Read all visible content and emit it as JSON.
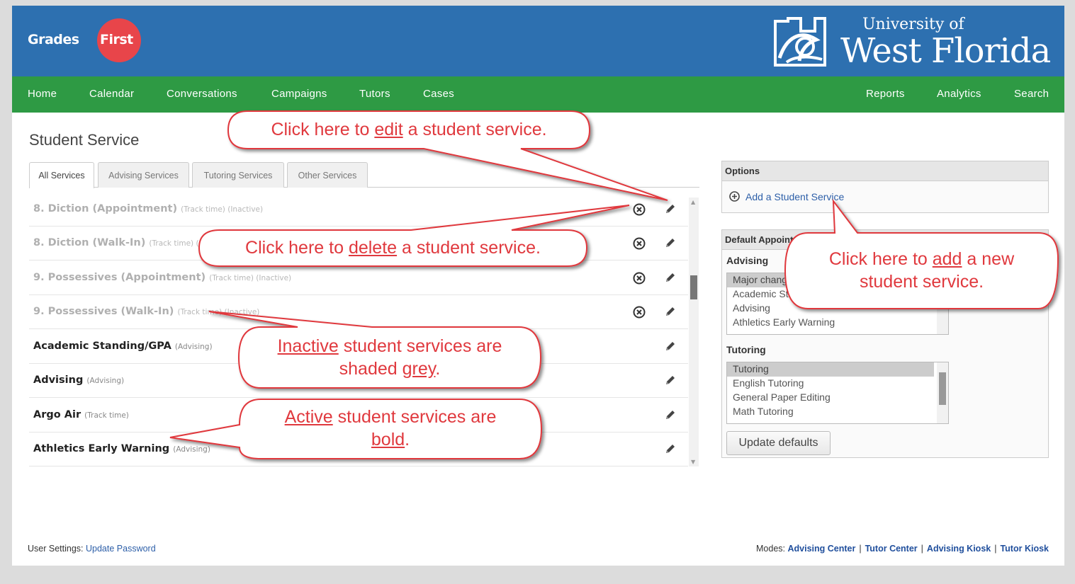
{
  "brand": {
    "gf_part1": "Grades",
    "gf_part2": "First",
    "uni_line1": "University of",
    "uni_line2": "West Florida"
  },
  "nav": {
    "left": [
      "Home",
      "Calendar",
      "Conversations",
      "Campaigns",
      "Tutors",
      "Cases"
    ],
    "right": [
      "Reports",
      "Analytics",
      "Search"
    ]
  },
  "page": {
    "title": "Student Service"
  },
  "tabs": [
    "All Services",
    "Advising Services",
    "Tutoring Services",
    "Other Services"
  ],
  "services": [
    {
      "name": "8. Diction (Appointment)",
      "meta": "(Track time) (Inactive)",
      "status": "inactive"
    },
    {
      "name": "8. Diction (Walk-In)",
      "meta": "(Track time) (Inactive)",
      "status": "inactive"
    },
    {
      "name": "9. Possessives (Appointment)",
      "meta": "(Track time) (Inactive)",
      "status": "inactive"
    },
    {
      "name": "9. Possessives (Walk-In)",
      "meta": "(Track time) (Inactive)",
      "status": "inactive"
    },
    {
      "name": "Academic Standing/GPA",
      "meta": "(Advising)",
      "status": "active"
    },
    {
      "name": "Advising",
      "meta": "(Advising)",
      "status": "active"
    },
    {
      "name": "Argo Air",
      "meta": "(Track time)",
      "status": "active"
    },
    {
      "name": "Athletics Early Warning",
      "meta": "(Advising)",
      "status": "active"
    }
  ],
  "options": {
    "header": "Options",
    "add_link": "Add a Student Service"
  },
  "defaults": {
    "header": "Default Appointment",
    "advising_label": "Advising",
    "advising_options": [
      "Major change",
      "Academic Standing/GPA",
      "Advising",
      "Athletics Early Warning"
    ],
    "tutoring_label": "Tutoring",
    "tutoring_options": [
      "Tutoring",
      "English Tutoring",
      "General Paper Editing",
      "Math Tutoring"
    ],
    "update_button": "Update defaults"
  },
  "footer": {
    "settings_label": "User Settings:",
    "update_password": "Update Password",
    "modes_label": "Modes:",
    "modes": [
      "Advising Center",
      "Tutor Center",
      "Advising Kiosk",
      "Tutor Kiosk"
    ]
  },
  "callouts": {
    "edit": {
      "pre": "Click here to ",
      "u": "edit",
      "post": " a student service."
    },
    "delete": {
      "pre": "Click here to ",
      "u": "delete",
      "post": " a student service."
    },
    "add": {
      "pre": "Click here to ",
      "u": "add",
      "post": " a new",
      "line2": "student service."
    },
    "inactive": {
      "u1": "Inactive",
      "mid": " student services are",
      "pre2": "shaded ",
      "u2": "grey",
      "post": "."
    },
    "active": {
      "u1": "Active",
      "mid": " student services are",
      "u2": "bold",
      "post": "."
    }
  },
  "colors": {
    "header_blue": "#2d70b0",
    "nav_green": "#2e9a44",
    "callout_red": "#e0393e",
    "logo_red": "#e8454a"
  }
}
